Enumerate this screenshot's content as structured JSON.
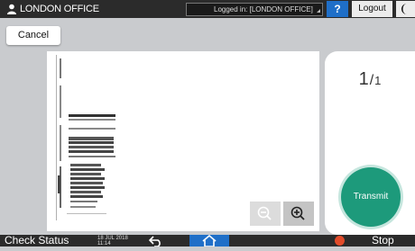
{
  "header": {
    "user_name": "LONDON OFFICE",
    "login_status": "Logged in: [LONDON OFFICE]",
    "help_label": "?",
    "logout_label": "Logout"
  },
  "toolbar": {
    "cancel_label": "Cancel"
  },
  "preview": {
    "zoom_out_icon": "zoom-out-icon",
    "zoom_in_icon": "zoom-in-icon"
  },
  "side_panel": {
    "current_page": "1",
    "separator": "/",
    "total_pages": "1",
    "transmit_label": "Transmit"
  },
  "footer": {
    "check_status_label": "Check Status",
    "date": "18 JUL 2018",
    "time": "11:14",
    "stop_label": "Stop"
  },
  "colors": {
    "accent_blue": "#1f6fc8",
    "transmit_green": "#1d9a7b",
    "stop_red": "#e24b2a",
    "bar_dark": "#2b2b2b"
  }
}
